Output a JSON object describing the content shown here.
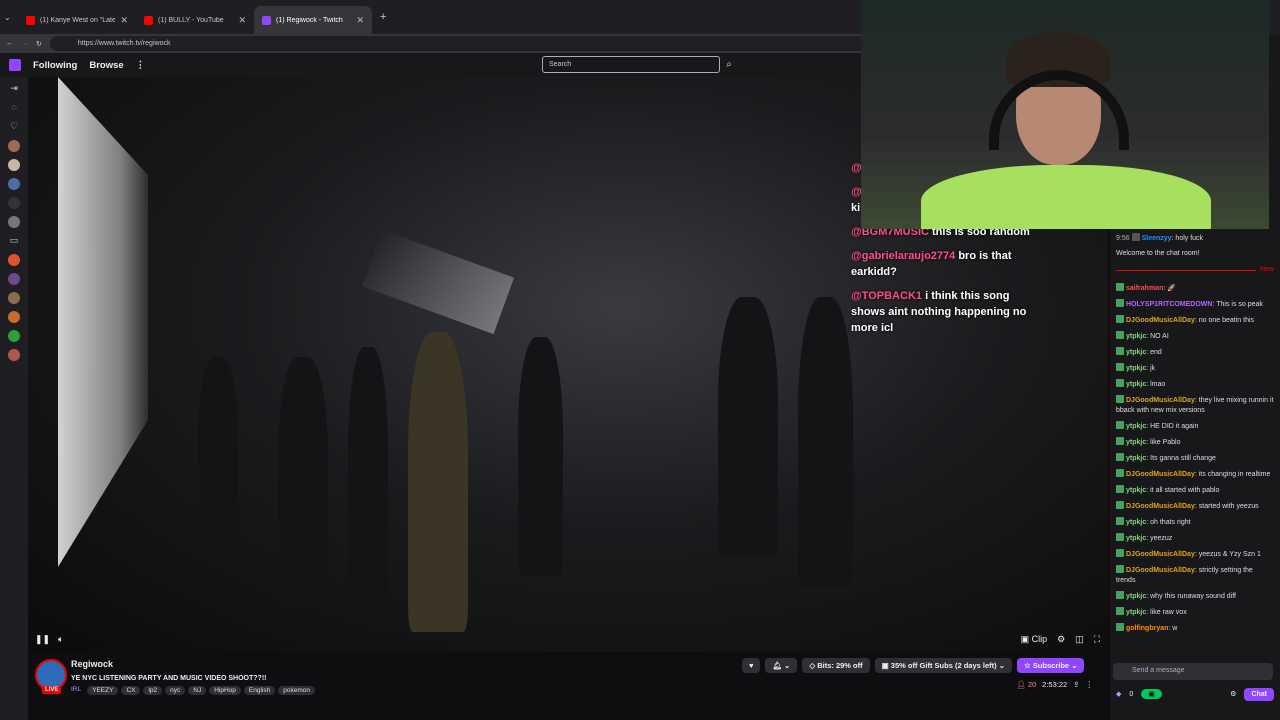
{
  "browser": {
    "tabs": [
      {
        "title": "(1) Kanye West on \"Late Night wit",
        "favicon_color": "#ff0000"
      },
      {
        "title": "(1) BULLY - YouTube",
        "favicon_color": "#ff0000"
      },
      {
        "title": "(1) Regiwock - Twitch",
        "favicon_color": "#9146ff"
      }
    ],
    "new_tab": "+",
    "url": "https://www.twitch.tv/regiwock"
  },
  "nav": {
    "following": "Following",
    "browse": "Browse",
    "more": "⋮",
    "search_placeholder": "Search"
  },
  "video_overlay_chat": [
    {
      "user": "@",
      "text": ""
    },
    {
      "user": "@",
      "text": "ki"
    },
    {
      "user": "@BGM7MUSIC",
      "text": " this is soo random"
    },
    {
      "user": "@gabrielaraujo2774",
      "text": " bro is that earkidd?"
    },
    {
      "user": "@TOPBACK1",
      "text": " i think this song shows aint nothing happening no more icl"
    }
  ],
  "player": {
    "clip": "Clip"
  },
  "stream": {
    "channel": "Regiwock",
    "live": "LIVE",
    "title": "YE NYC LISTENING PARTY AND MUSIC VIDEO SHOOT??!!",
    "category": "IRL",
    "tags": [
      "YEEZY",
      "CX",
      "lp2",
      "nyc",
      "NJ",
      "HipHop",
      "English",
      "pokemon"
    ],
    "bits": "Bits: 29% off",
    "gift": "35% off Gift Subs (2 days left)",
    "subscribe": "Subscribe",
    "viewers": "20",
    "uptime": "2:53:22"
  },
  "chat": {
    "pinned": {
      "time": "9:56",
      "user": "Sleenzyy",
      "text": ": holy fuck"
    },
    "welcome": "Welcome to the chat room!",
    "new_label": "New",
    "messages": [
      {
        "user": "saifrahman",
        "color": "#ff4d4d",
        "text": ": 🚀"
      },
      {
        "user": "HOLYSP1RITCOMEDOWN",
        "color": "#b667ff",
        "text": ": This is so peak"
      },
      {
        "user": "DJGoodMusicAllDay",
        "color": "#daa520",
        "text": ": no one beatin this"
      },
      {
        "user": "ytpkjc",
        "color": "#7fd67f",
        "text": ": NO AI"
      },
      {
        "user": "ytpkjc",
        "color": "#7fd67f",
        "text": ": end"
      },
      {
        "user": "ytpkjc",
        "color": "#7fd67f",
        "text": ": jk"
      },
      {
        "user": "ytpkjc",
        "color": "#7fd67f",
        "text": ": lmao"
      },
      {
        "user": "DJGoodMusicAllDay",
        "color": "#daa520",
        "text": ": they live mixing runnin it bback with new mix versions"
      },
      {
        "user": "ytpkjc",
        "color": "#7fd67f",
        "text": ": HE DID it again"
      },
      {
        "user": "ytpkjc",
        "color": "#7fd67f",
        "text": ": like Pablo"
      },
      {
        "user": "ytpkjc",
        "color": "#7fd67f",
        "text": ": Its ganna still change"
      },
      {
        "user": "DJGoodMusicAllDay",
        "color": "#daa520",
        "text": ": its changing in realtime"
      },
      {
        "user": "ytpkjc",
        "color": "#7fd67f",
        "text": ": it all started with pablo"
      },
      {
        "user": "DJGoodMusicAllDay",
        "color": "#daa520",
        "text": ": started with yeezus"
      },
      {
        "user": "ytpkjc",
        "color": "#7fd67f",
        "text": ": oh thats right"
      },
      {
        "user": "ytpkjc",
        "color": "#7fd67f",
        "text": ": yeezuz"
      },
      {
        "user": "DJGoodMusicAllDay",
        "color": "#daa520",
        "text": ": yeezus & Yzy Szn 1"
      },
      {
        "user": "DJGoodMusicAllDay",
        "color": "#daa520",
        "text": ": strictly setting the trends"
      },
      {
        "user": "ytpkjc",
        "color": "#7fd67f",
        "text": ": why this runaway sound diff"
      },
      {
        "user": "ytpkjc",
        "color": "#7fd67f",
        "text": ": like raw vox"
      },
      {
        "user": "golfingbryan",
        "color": "#ff8c00",
        "text": ": w"
      }
    ],
    "input_placeholder": "Send a message",
    "points": "0",
    "chat_button": "Chat"
  },
  "colors": {
    "accent": "#9146ff",
    "live": "#eb0400"
  }
}
